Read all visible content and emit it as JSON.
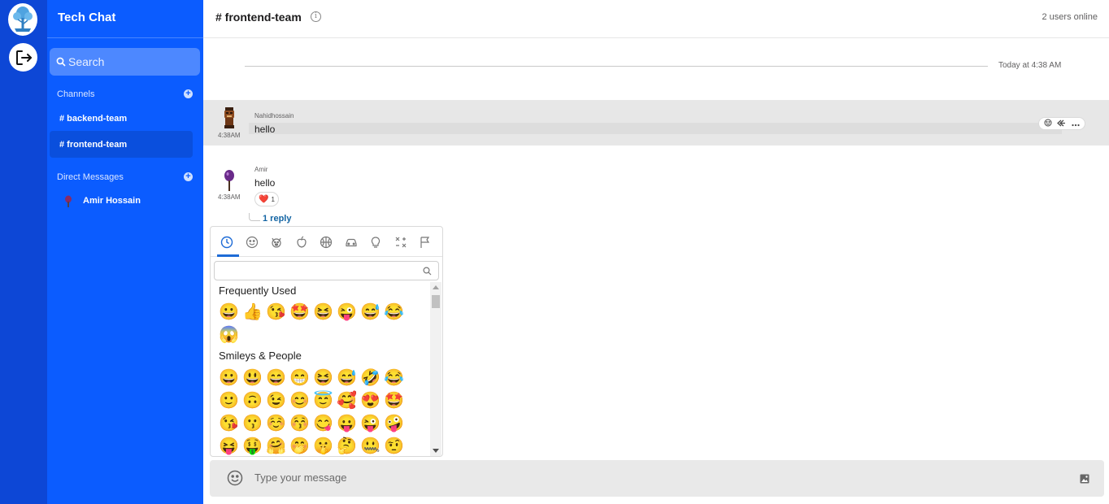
{
  "app": {
    "title": "Tech Chat"
  },
  "sidebar": {
    "search_placeholder": "Search",
    "channels_heading": "Channels",
    "channels": [
      {
        "label": "# backend-team",
        "active": false
      },
      {
        "label": "# frontend-team",
        "active": true
      }
    ],
    "dm_heading": "Direct Messages",
    "direct_messages": [
      {
        "label": "Amir Hossain"
      }
    ]
  },
  "header": {
    "channel": "# frontend-team",
    "info_icon": "i",
    "online": "2 users online"
  },
  "divider": {
    "label": "Today at 4:38 AM"
  },
  "messages": [
    {
      "author": "Nahidhossain",
      "text": "hello",
      "time": "4:38AM",
      "avatar_icon": "tiki-avatar-icon"
    },
    {
      "author": "Amir",
      "text": "hello",
      "time": "4:38AM",
      "avatar_icon": "purple-avatar-icon",
      "reaction": {
        "emoji": "❤️",
        "count": "1"
      },
      "reply_link": "1 reply"
    }
  ],
  "emoji_picker": {
    "tabs": [
      "clock-icon",
      "smiley-icon",
      "dog-icon",
      "apple-icon",
      "basketball-icon",
      "car-icon",
      "lightbulb-icon",
      "symbols-icon",
      "flag-icon"
    ],
    "active_tab": 0,
    "search_value": "",
    "frequently_used_heading": "Frequently Used",
    "frequently_used": [
      "😀",
      "👍",
      "😘",
      "🤩",
      "😆",
      "😜",
      "😅",
      "😂",
      "😱"
    ],
    "smileys_heading": "Smileys & People",
    "smileys": [
      [
        "😀",
        "😃",
        "😄",
        "😁",
        "😆",
        "😅",
        "🤣",
        "😂"
      ],
      [
        "🙂",
        "🙃",
        "😉",
        "😊",
        "😇",
        "🥰",
        "😍",
        "🤩"
      ],
      [
        "😘",
        "😗",
        "☺️",
        "😚",
        "😋",
        "😛",
        "😜",
        "🤪"
      ],
      [
        "😝",
        "🤑",
        "🤗",
        "🤭",
        "🤫",
        "🤔",
        "🤐",
        "🤨"
      ]
    ]
  },
  "composer": {
    "placeholder": "Type your message"
  },
  "colors": {
    "rail": "#0d47d6",
    "sidebar": "#0b5cff",
    "accent": "#1e6bd6",
    "reply_link": "#1264a3"
  }
}
